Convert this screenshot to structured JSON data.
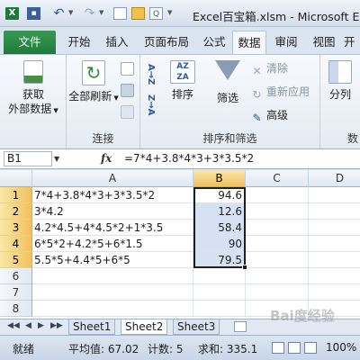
{
  "window": {
    "title": "Excel百宝箱.xlsm - Microsoft Ex"
  },
  "quick_access": {
    "app_icon": "X",
    "save_icon": "▪",
    "undo_icon": "↶",
    "redo_icon": "↷",
    "preview_icon": "Q"
  },
  "tabs": [
    {
      "label": "文件",
      "active": false
    },
    {
      "label": "开始",
      "active": false
    },
    {
      "label": "插入",
      "active": false
    },
    {
      "label": "页面布局",
      "active": false
    },
    {
      "label": "公式",
      "active": false
    },
    {
      "label": "数据",
      "active": true
    },
    {
      "label": "审阅",
      "active": false
    },
    {
      "label": "视图",
      "active": false
    },
    {
      "label": "开",
      "active": false
    }
  ],
  "ribbon": {
    "get_external": {
      "line1": "获取",
      "line2": "外部数据"
    },
    "refresh_all": "全部刷新",
    "connections_group": "连接",
    "sort_az": "A→Z",
    "sort_za": "Z→A",
    "sort": "排序",
    "filter": "筛选",
    "clear": "清除",
    "reapply": "重新应用",
    "advanced": "高级",
    "sort_filter_group": "排序和筛选",
    "split": "分列",
    "data_group_partial": "数"
  },
  "formula_bar": {
    "name_box": "B1",
    "fx": "fx",
    "formula": "=7*4+3.8*4*3+3*3.5*2"
  },
  "columns": [
    "A",
    "B",
    "C",
    "D"
  ],
  "rows": [
    {
      "num": "1",
      "a": "7*4+3.8*4*3+3*3.5*2",
      "b": "94.6"
    },
    {
      "num": "2",
      "a": "3*4.2",
      "b": "12.6"
    },
    {
      "num": "3",
      "a": "4.2*4.5+4*4.5*2+1*3.5",
      "b": "58.4"
    },
    {
      "num": "4",
      "a": "6*5*2+4.2*5+6*1.5",
      "b": "90"
    },
    {
      "num": "5",
      "a": "5.5*5+4.4*5+6*5",
      "b": "79.5"
    },
    {
      "num": "6",
      "a": "",
      "b": ""
    },
    {
      "num": "7",
      "a": "",
      "b": ""
    },
    {
      "num": "8",
      "a": "",
      "b": ""
    }
  ],
  "sheets": [
    "Sheet1",
    "Sheet2",
    "Sheet3"
  ],
  "sheet_nav": [
    "◀◀",
    "◀",
    "▶",
    "▶▶"
  ],
  "status": {
    "ready": "就绪",
    "average": "平均值: 67.02",
    "count": "计数: 5",
    "sum": "求和: 335.1",
    "zoom": "100%"
  },
  "watermark": "Bai度经验"
}
